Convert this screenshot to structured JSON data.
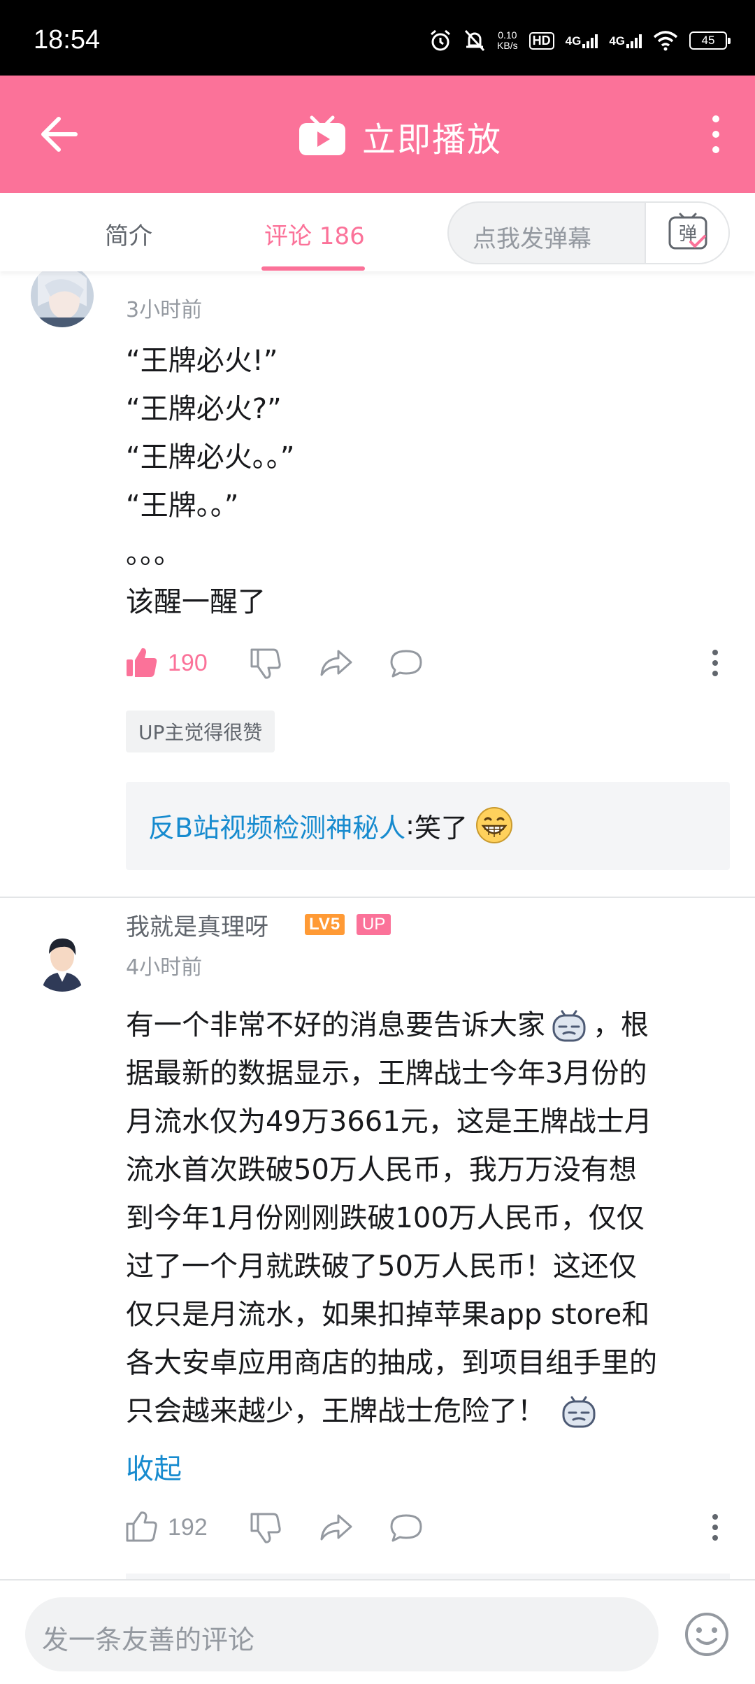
{
  "status_bar": {
    "time": "18:54",
    "net_speed_value": "0.10",
    "net_speed_unit": "KB/s",
    "hd": "HD",
    "sim1": "4G",
    "sim2": "4G",
    "battery": "45"
  },
  "header": {
    "title": "立即播放",
    "accent_color": "#fb7299"
  },
  "tabs": {
    "intro": "简介",
    "comments": "评论 186",
    "danmaku_placeholder": "点我发弹幕",
    "danmaku_btn": "弹"
  },
  "comments": [
    {
      "time": "3小时前",
      "lines": [
        "“王牌必火!”",
        "“王牌必火?”",
        "“王牌必火。。”",
        "“王牌。。”",
        "。。。",
        "该醒一醒了"
      ],
      "likes": "190",
      "liked": true,
      "up_tag": "UP主觉得很赞",
      "reply": {
        "user": "反B站视频检测神秘人",
        "sep": ": ",
        "text": "笑了"
      }
    },
    {
      "username": "我就是真理呀",
      "level": "LV5",
      "up_badge": "UP",
      "time": "4小时前",
      "lines": [
        "有一个非常不好的消息要告诉大家",
        "，根",
        "据最新的数据显示，王牌战士今年3月份的",
        "月流水仅为49万3661元，这是王牌战士月",
        "流水首次跌破50万人民币，我万万没有想",
        "到今年1月份刚刚跌破100万人民币，仅仅",
        "过了一个月就跌破了50万人民币！这还仅",
        "仅只是月流水，如果扣掉苹果app store和",
        "各大安卓应用商店的抽成，到项目组手里的",
        "只会越来越少，王牌战士危险了！"
      ],
      "collapse": "收起",
      "likes": "192",
      "liked": false
    }
  ],
  "bottom_bar": {
    "placeholder": "发一条友善的评论"
  }
}
